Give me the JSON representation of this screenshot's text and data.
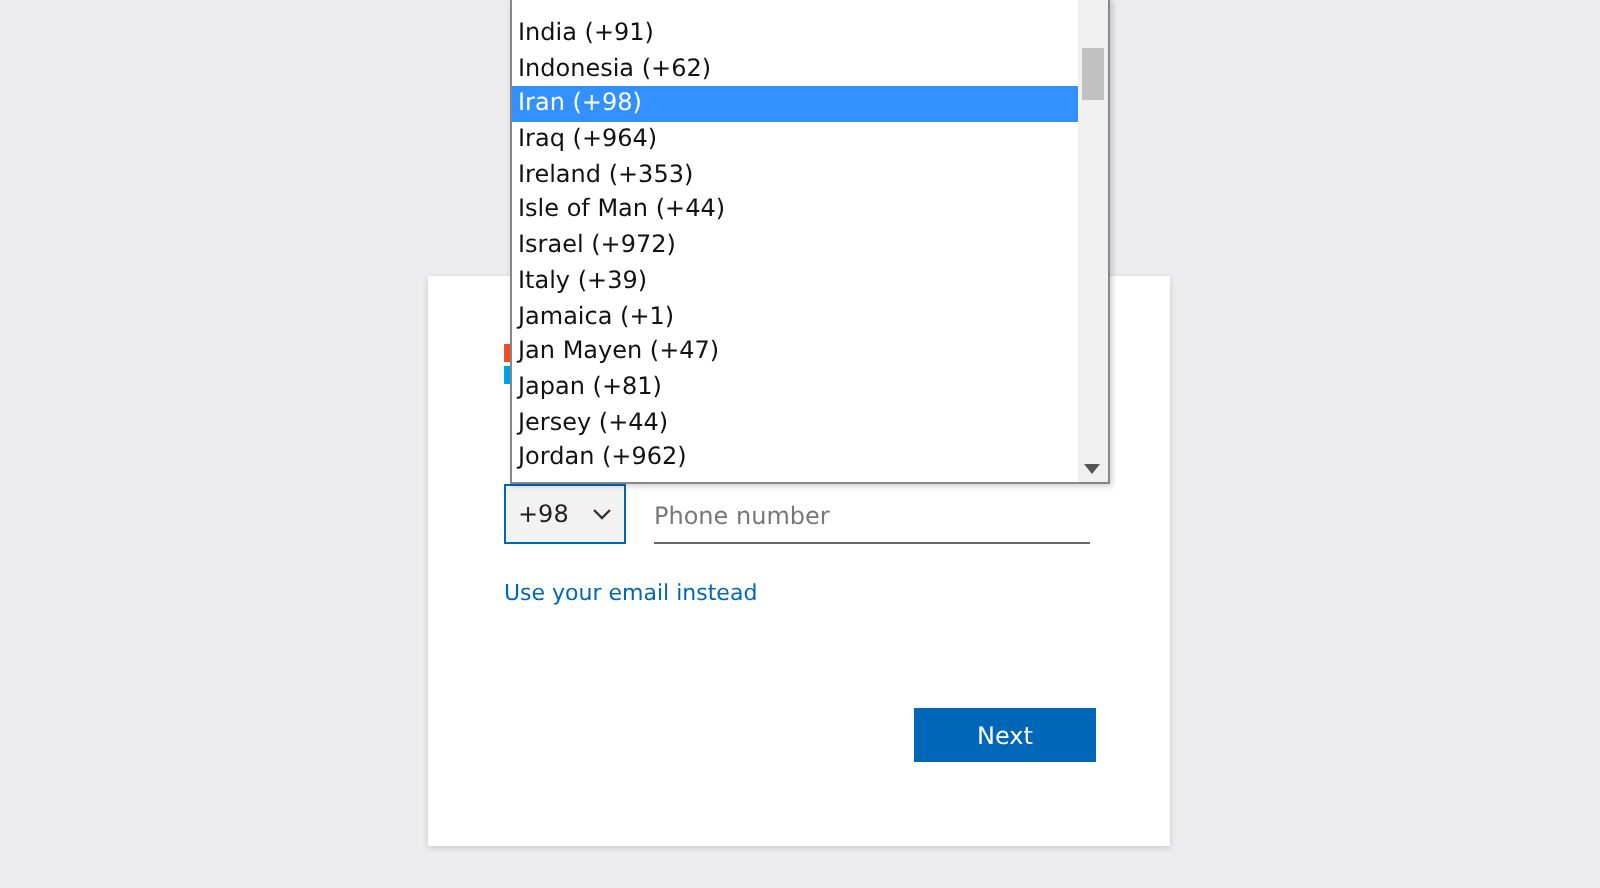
{
  "form": {
    "country_code": "+98",
    "phone": {
      "placeholder": "Phone number"
    },
    "link": "Use your email instead",
    "button": "Next"
  },
  "dropdown": {
    "options": [
      {
        "label": "India (+91)",
        "selected": false
      },
      {
        "label": "Indonesia (+62)",
        "selected": false
      },
      {
        "label": "Iran (+98)",
        "selected": true
      },
      {
        "label": "Iraq (+964)",
        "selected": false
      },
      {
        "label": "Ireland (+353)",
        "selected": false
      },
      {
        "label": "Isle of Man (+44)",
        "selected": false
      },
      {
        "label": "Israel (+972)",
        "selected": false
      },
      {
        "label": "Italy (+39)",
        "selected": false
      },
      {
        "label": "Jamaica (+1)",
        "selected": false
      },
      {
        "label": "Jan Mayen (+47)",
        "selected": false
      },
      {
        "label": "Japan (+81)",
        "selected": false
      },
      {
        "label": "Jersey (+44)",
        "selected": false
      },
      {
        "label": "Jordan (+962)",
        "selected": false
      }
    ]
  }
}
